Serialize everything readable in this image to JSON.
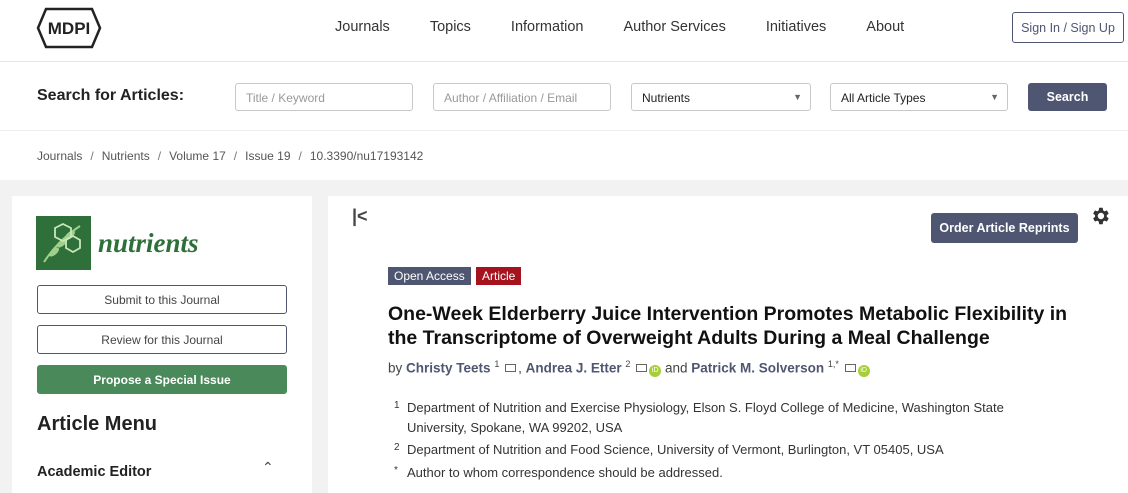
{
  "nav": {
    "logo_text": "MDPI",
    "links": [
      "Journals",
      "Topics",
      "Information",
      "Author Services",
      "Initiatives",
      "About"
    ],
    "signin_label": "Sign In / Sign Up"
  },
  "search": {
    "label": "Search for Articles:",
    "title_placeholder": "Title / Keyword",
    "author_placeholder": "Author / Affiliation / Email",
    "journal_selected": "Nutrients",
    "type_selected": "All Article Types",
    "button_label": "Search"
  },
  "breadcrumb": [
    "Journals",
    "Nutrients",
    "Volume 17",
    "Issue 19",
    "10.3390/nu17193142"
  ],
  "sidebar": {
    "journal_name": "nutrients",
    "submit_label": "Submit to this Journal",
    "review_label": "Review for this Journal",
    "propose_label": "Propose a Special Issue",
    "menu_title": "Article Menu",
    "menu_item": "Academic Editor"
  },
  "article": {
    "reprints_label": "Order Article Reprints",
    "badge_open_access": "Open Access",
    "badge_type": "Article",
    "title": "One-Week Elderberry Juice Intervention Promotes Metabolic Flexibility in the Transcriptome of Overweight Adults During a Meal Challenge",
    "by": "by",
    "and": "and",
    "authors": [
      {
        "name": "Christy Teets",
        "sup": "1"
      },
      {
        "name": "Andrea J. Etter",
        "sup": "2"
      },
      {
        "name": "Patrick M. Solverson",
        "sup": "1,*"
      }
    ],
    "affiliations": [
      {
        "num": "1",
        "text": "Department of Nutrition and Exercise Physiology, Elson S. Floyd College of Medicine, Washington State University, Spokane, WA 99202, USA"
      },
      {
        "num": "2",
        "text": "Department of Nutrition and Food Science, University of Vermont, Burlington, VT 05405, USA"
      },
      {
        "num": "*",
        "text": "Author to whom correspondence should be addressed."
      }
    ]
  },
  "colors": {
    "brand": "#4f5671",
    "journal_green": "#2e6f3a",
    "article_badge": "#a5141e"
  }
}
